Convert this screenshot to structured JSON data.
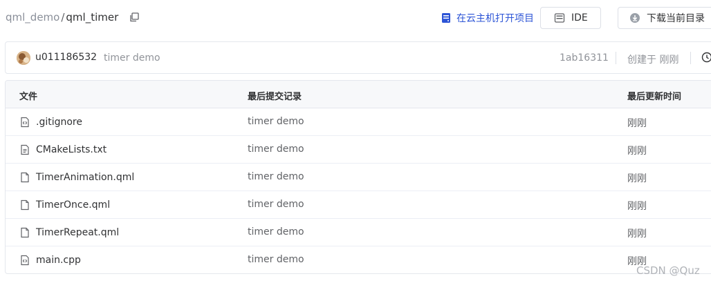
{
  "breadcrumb": {
    "repo": "qml_demo",
    "separator": "/",
    "current": "qml_timer"
  },
  "actions": {
    "open_cloud_label": "在云主机打开项目",
    "ide_label": "IDE",
    "download_label": "下载当前目录"
  },
  "commit": {
    "user": "u011186532",
    "message": "timer demo",
    "hash": "1ab16311",
    "created": "创建于 刚刚"
  },
  "table": {
    "headers": {
      "file": "文件",
      "last_commit": "最后提交记录",
      "last_update": "最后更新时间"
    },
    "rows": [
      {
        "icon": "code-file-icon",
        "name": ".gitignore",
        "commit": "timer demo",
        "time": "刚刚"
      },
      {
        "icon": "text-file-icon",
        "name": "CMakeLists.txt",
        "commit": "timer demo",
        "time": "刚刚"
      },
      {
        "icon": "file-icon",
        "name": "TimerAnimation.qml",
        "commit": "timer demo",
        "time": "刚刚"
      },
      {
        "icon": "file-icon",
        "name": "TimerOnce.qml",
        "commit": "timer demo",
        "time": "刚刚"
      },
      {
        "icon": "file-icon",
        "name": "TimerRepeat.qml",
        "commit": "timer demo",
        "time": "刚刚"
      },
      {
        "icon": "code-file-icon",
        "name": "main.cpp",
        "commit": "timer demo",
        "time": "刚刚"
      }
    ]
  },
  "watermark": "CSDN @Quz",
  "colors": {
    "link": "#2c54d6",
    "muted": "#909399",
    "border": "#e4e7ed",
    "header_bg": "#f7f8fa"
  }
}
